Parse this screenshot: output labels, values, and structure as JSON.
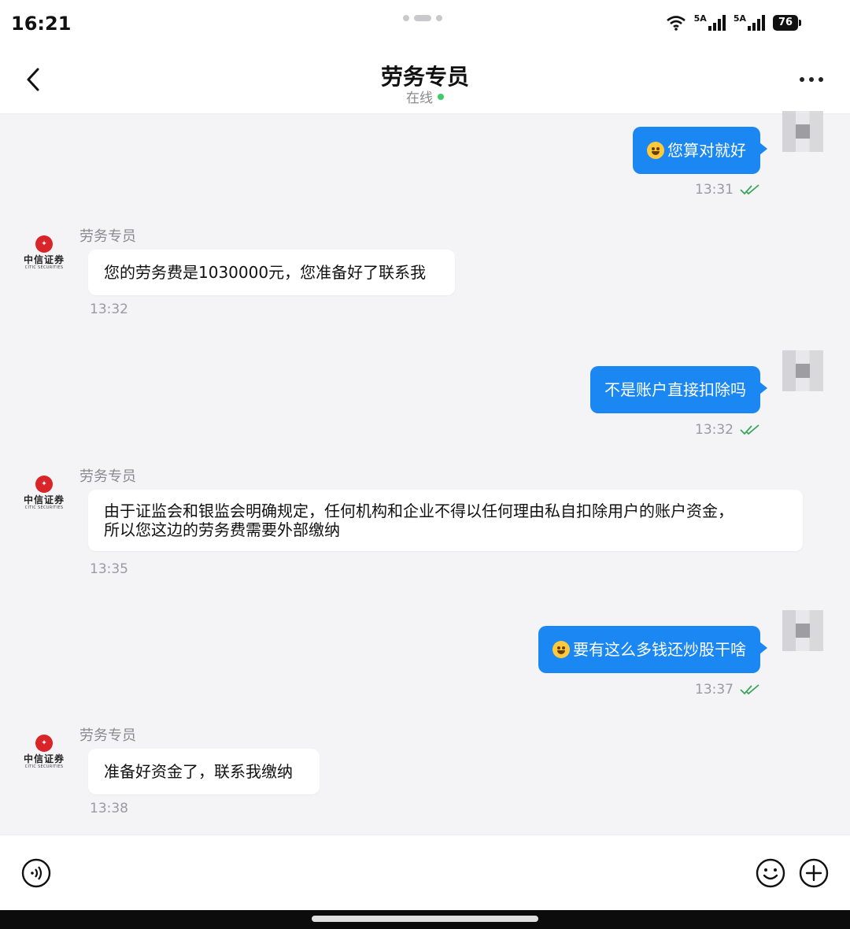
{
  "status_bar": {
    "time": "16:21",
    "network_1": "5A",
    "network_2": "5A",
    "battery": "76"
  },
  "header": {
    "title": "劳务专员",
    "status": "在线"
  },
  "contact": {
    "name": "劳务专员",
    "avatar_logo_cn": "中信证券",
    "avatar_logo_en": "CITIC SECURITIES"
  },
  "messages": [
    {
      "direction": "out",
      "text": "您算对就好",
      "time": "13:31",
      "emoji": "smiling-hearts-emoji"
    },
    {
      "direction": "in",
      "sender": "劳务专员",
      "text": "您的劳务费是1030000元，您准备好了联系我",
      "time": "13:32"
    },
    {
      "direction": "out",
      "text": "不是账户直接扣除吗",
      "time": "13:32"
    },
    {
      "direction": "in",
      "sender": "劳务专员",
      "text_line1": "由于证监会和银监会明确规定，任何机构和企业不得以任何理由私自扣除用户的账户资金，",
      "text_line2": "所以您这边的劳务费需要外部缴纳",
      "time": "13:35"
    },
    {
      "direction": "out",
      "text": "要有这么多钱还炒股干啥",
      "time": "13:37",
      "emoji": "grinning-sweat-emoji"
    },
    {
      "direction": "in",
      "sender": "劳务专员",
      "text": "准备好资金了，联系我缴纳",
      "time": "13:38"
    }
  ],
  "colors": {
    "outgoing_bubble": "#1a87f2",
    "incoming_bubble": "#ffffff",
    "chat_background": "#f4f4f6",
    "online_dot": "#3ccb6a"
  },
  "icons": {
    "back": "chevron-left-icon",
    "more": "more-dots-icon",
    "voice": "voice-icon",
    "emoji": "emoji-icon",
    "add": "plus-circle-icon",
    "read": "double-check-icon"
  }
}
